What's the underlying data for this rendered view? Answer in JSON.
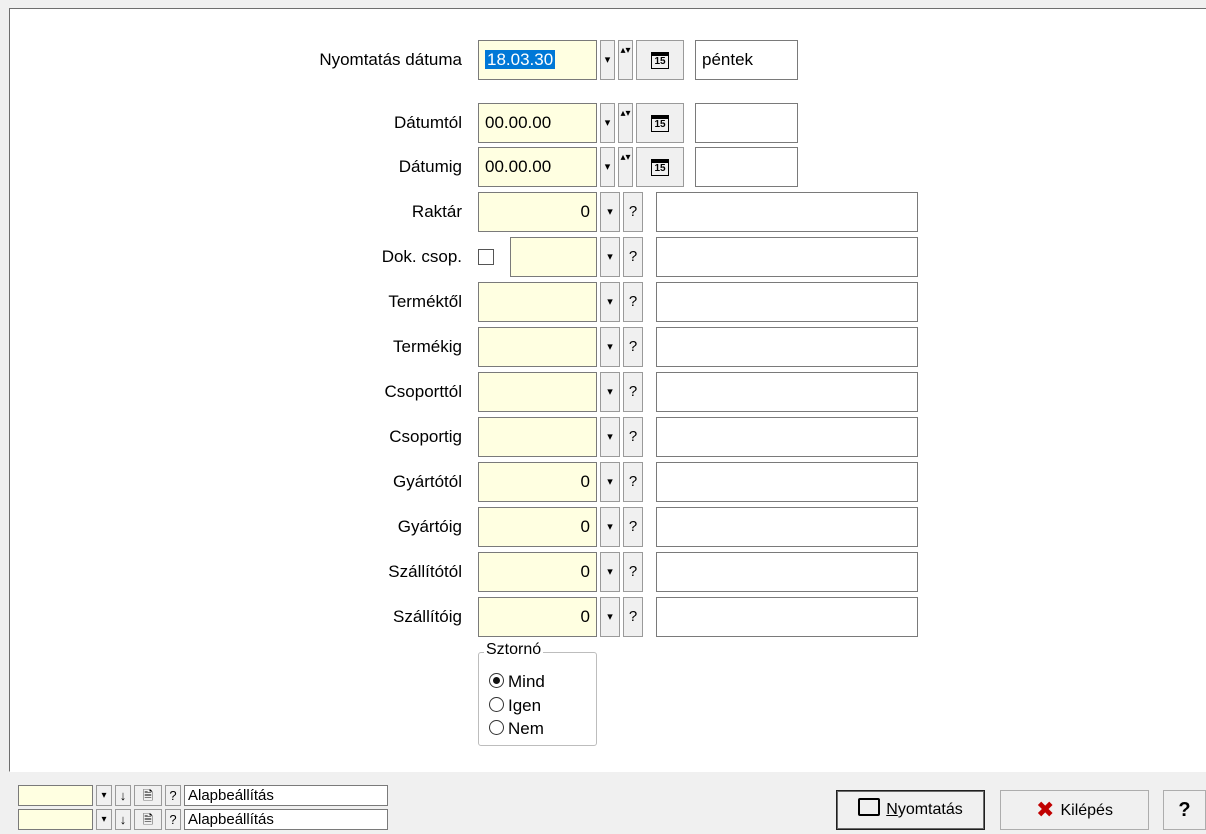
{
  "form": {
    "print_date": {
      "label": "Nyomtatás dátuma",
      "value": "18.03.30",
      "day": "péntek"
    },
    "date_from": {
      "label": "Dátumtól",
      "value": "00.00.00",
      "day": ""
    },
    "date_to": {
      "label": "Dátumig",
      "value": "00.00.00",
      "day": ""
    },
    "warehouse": {
      "label": "Raktár",
      "value": "0",
      "desc": ""
    },
    "doc_group": {
      "label": "Dok. csop.",
      "checked": false,
      "value": "",
      "desc": ""
    },
    "product_from": {
      "label": "Terméktől",
      "value": "",
      "desc": ""
    },
    "product_to": {
      "label": "Termékig",
      "value": "",
      "desc": ""
    },
    "group_from": {
      "label": "Csoporttól",
      "value": "",
      "desc": ""
    },
    "group_to": {
      "label": "Csoportig",
      "value": "",
      "desc": ""
    },
    "manufacturer_from": {
      "label": "Gyártótól",
      "value": "0",
      "desc": ""
    },
    "manufacturer_to": {
      "label": "Gyártóig",
      "value": "0",
      "desc": ""
    },
    "supplier_from": {
      "label": "Szállítótól",
      "value": "0",
      "desc": ""
    },
    "supplier_to": {
      "label": "Szállítóig",
      "value": "0",
      "desc": ""
    },
    "storno": {
      "legend": "Sztornó",
      "options": [
        "Mind",
        "Igen",
        "Nem"
      ],
      "selected": "Mind"
    }
  },
  "controls": {
    "dropdown_glyph": "▾",
    "spin_glyph": "▴▾",
    "calendar_glyph": "15",
    "help_glyph": "?"
  },
  "footer": {
    "presets": [
      {
        "label": "Alapbeállítás"
      },
      {
        "label": "Alapbeállítás"
      }
    ],
    "print_button_hotkey": "N",
    "print_button_rest": "yomtatás",
    "exit_button": "Kilépés",
    "help_button": "?"
  },
  "colors": {
    "field_bg": "#ffffe1",
    "selection": "#0078d7",
    "exit_icon": "#c00000"
  }
}
